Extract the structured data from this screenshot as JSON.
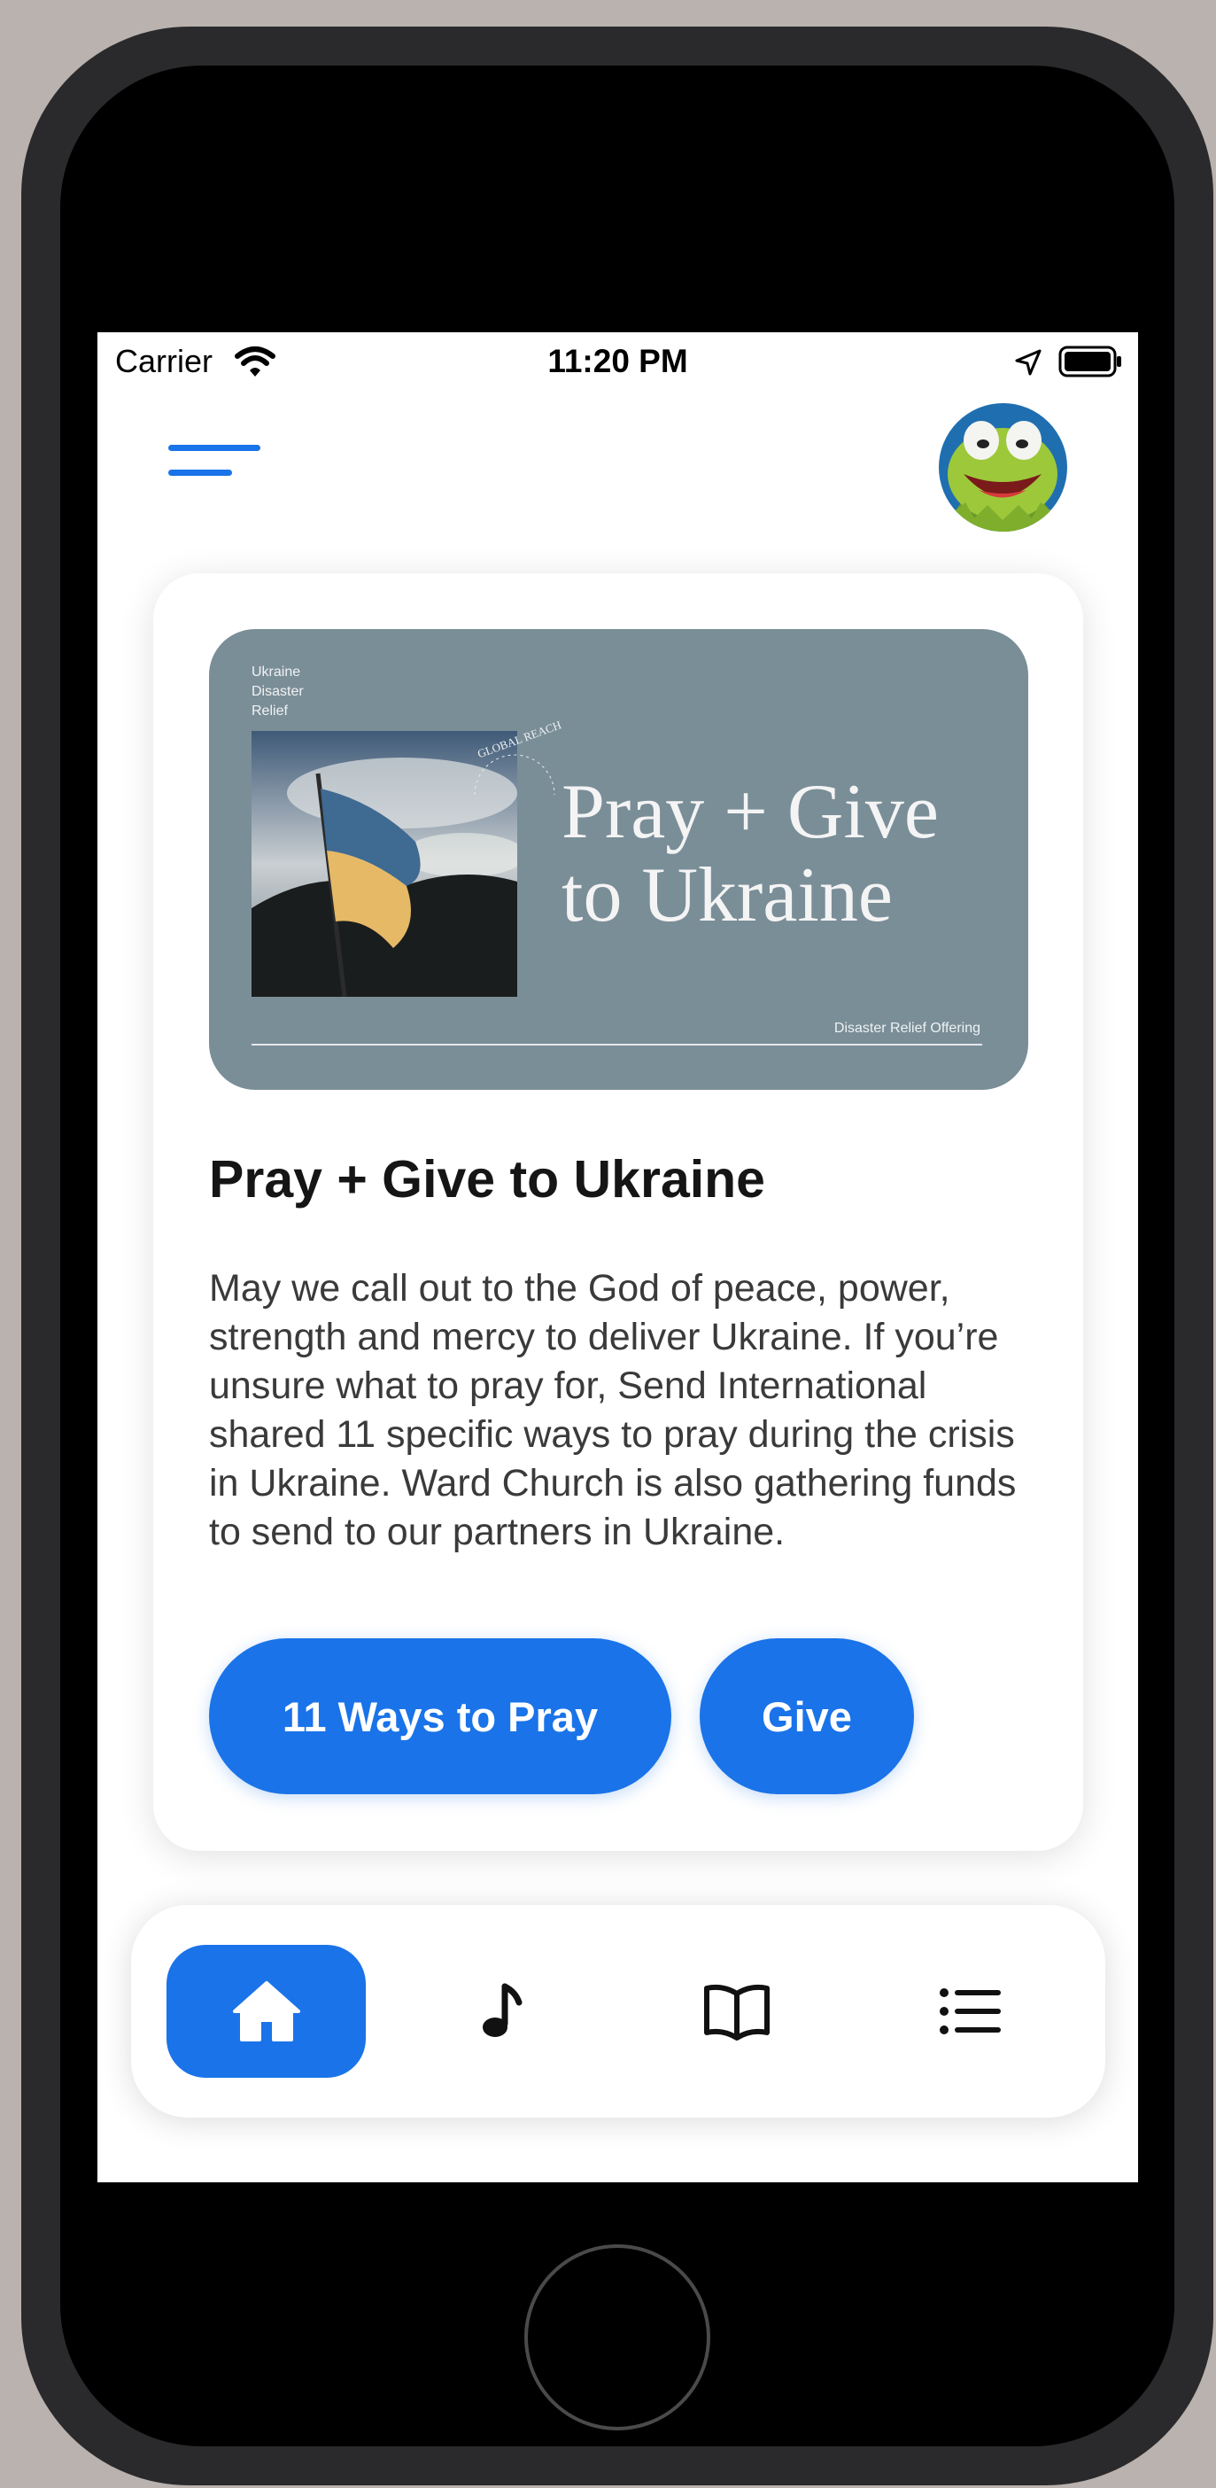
{
  "status_bar": {
    "carrier": "Carrier",
    "time": "11:20 PM"
  },
  "header": {
    "menu_icon": "hamburger-menu-icon",
    "avatar": "profile-avatar"
  },
  "card": {
    "banner": {
      "tag_lines": [
        "Ukraine",
        "Disaster",
        "Relief"
      ],
      "arc_text": "GLOBAL REACH",
      "title_line1": "Pray + Give",
      "title_line2": "to Ukraine",
      "footer": "Disaster Relief Offering"
    },
    "title": "Pray + Give to Ukraine",
    "body": "May we call out to the God of peace, power, strength and mercy to deliver Ukraine. If you’re unsure what to pray for, Send International shared 11 specific ways to pray during the crisis in Ukraine. Ward Church is also gathering funds to send to our partners in Ukraine.",
    "buttons": {
      "pray_label": "11 Ways to Pray",
      "give_label": "Give"
    }
  },
  "tab_bar": {
    "tabs": [
      {
        "icon": "home-icon",
        "active": true
      },
      {
        "icon": "music-note-icon",
        "active": false
      },
      {
        "icon": "book-icon",
        "active": false
      },
      {
        "icon": "list-icon",
        "active": false
      }
    ]
  },
  "colors": {
    "accent": "#1a73e8",
    "banner": "#7a8e98",
    "text": "#151515"
  }
}
